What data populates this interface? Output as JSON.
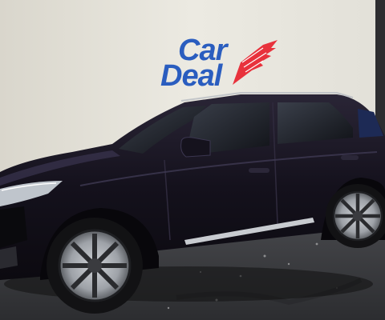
{
  "scene": {
    "description_free": true,
    "colors": {
      "wall": "#e6e3da",
      "floor": "#3a3b3d",
      "car_body": "#14111c",
      "logo_blue": "#2a5dbf",
      "logo_red": "#e8323c"
    }
  },
  "logo": {
    "line1": "Car",
    "line2": "Deal"
  }
}
